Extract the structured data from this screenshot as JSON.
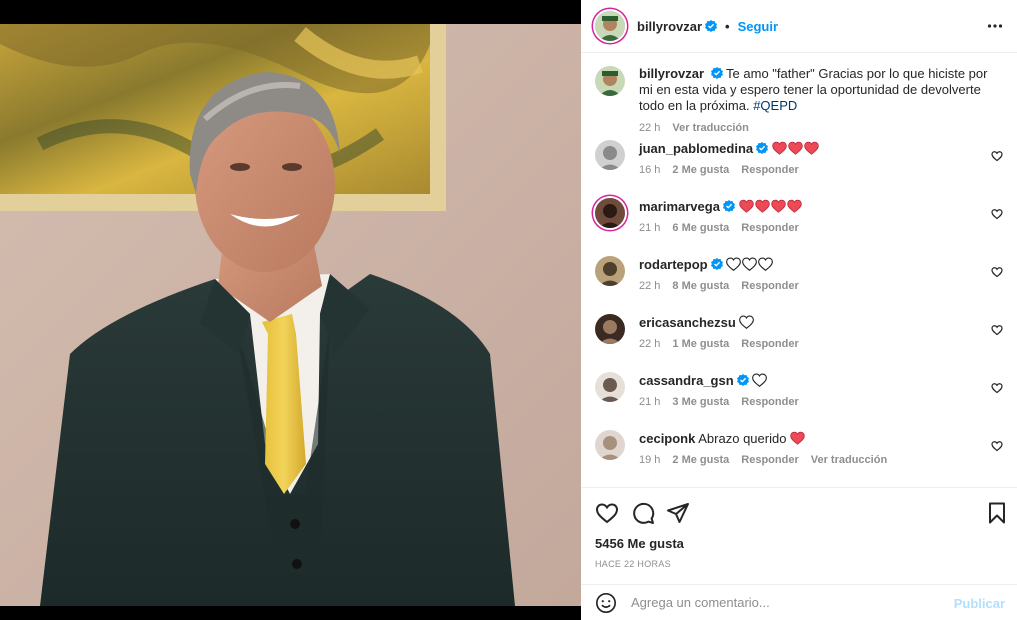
{
  "post": {
    "username": "billyrovzar",
    "follow_label": "Seguir",
    "separator": "•",
    "caption_text": "Te amo \"father\" Gracias por lo que hiciste por mi en esta vida y espero tener la oportunidad de devolverte todo en la próxima.",
    "caption_hashtag": "#QEPD",
    "caption_time": "22 h",
    "caption_translate": "Ver traducción",
    "likes_label": "5456 Me gusta",
    "time_ago": "HACE 22 HORAS"
  },
  "comments": [
    {
      "username": "juan_pablomedina",
      "verified": true,
      "text": "",
      "emoji": [
        "red-heart",
        "red-heart",
        "red-heart"
      ],
      "time": "16 h",
      "likes": "2 Me gusta",
      "reply": "Responder",
      "translate": ""
    },
    {
      "username": "marimarvega",
      "verified": true,
      "text": "",
      "emoji": [
        "red-heart",
        "red-heart",
        "red-heart",
        "red-heart"
      ],
      "time": "21 h",
      "likes": "6 Me gusta",
      "reply": "Responder",
      "translate": ""
    },
    {
      "username": "rodartepop",
      "verified": true,
      "text": "",
      "emoji": [
        "white-heart",
        "white-heart",
        "white-heart"
      ],
      "time": "22 h",
      "likes": "8 Me gusta",
      "reply": "Responder",
      "translate": ""
    },
    {
      "username": "ericasanchezsu",
      "verified": false,
      "text": "",
      "emoji": [
        "white-heart"
      ],
      "time": "22 h",
      "likes": "1 Me gusta",
      "reply": "Responder",
      "translate": ""
    },
    {
      "username": "cassandra_gsn",
      "verified": true,
      "text": "",
      "emoji": [
        "white-heart"
      ],
      "time": "21 h",
      "likes": "3 Me gusta",
      "reply": "Responder",
      "translate": ""
    },
    {
      "username": "ceciponk",
      "verified": false,
      "text": "Abrazo querido",
      "emoji": [
        "red-heart"
      ],
      "time": "19 h",
      "likes": "2 Me gusta",
      "reply": "Responder",
      "translate": "Ver traducción"
    }
  ],
  "composer": {
    "placeholder": "Agrega un comentario...",
    "publish_label": "Publicar"
  },
  "colors": {
    "accent": "#0095f6",
    "heart_red": "#ed4956",
    "text_muted": "#8e8e8e"
  },
  "icons": {
    "header_more": "more-horizontal-icon",
    "verified": "verified-badge-icon",
    "comment_like": "heart-outline-icon",
    "like": "heart-outline-icon",
    "comment": "comment-bubble-icon",
    "share": "paper-plane-icon",
    "save": "bookmark-icon",
    "emoji": "smiley-face-icon"
  }
}
